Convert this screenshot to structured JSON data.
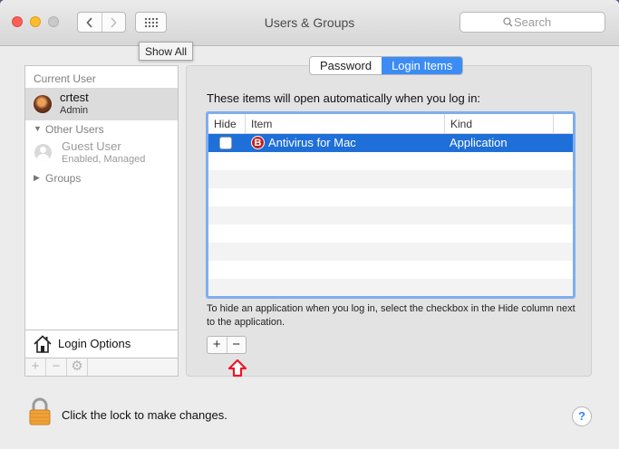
{
  "window": {
    "title": "Users & Groups"
  },
  "toolbar": {
    "back_icon": "chevron-left-icon",
    "forward_icon": "chevron-right-icon",
    "grid_icon": "grid-icon",
    "search_placeholder": "Search",
    "tooltip": "Show All"
  },
  "sidebar": {
    "current_user_header": "Current User",
    "current_user": {
      "name": "crtest",
      "role": "Admin"
    },
    "other_users_header": "Other Users",
    "guest": {
      "name": "Guest User",
      "status": "Enabled, Managed"
    },
    "groups_label": "Groups",
    "login_options": "Login Options",
    "buttons": [
      "+",
      "−",
      "⚙"
    ]
  },
  "tabs": [
    {
      "label": "Password",
      "selected": false
    },
    {
      "label": "Login Items",
      "selected": true
    }
  ],
  "login_items": {
    "intro": "These items will open automatically when you log in:",
    "columns": [
      "Hide",
      "Item",
      "Kind"
    ],
    "rows": [
      {
        "hide": false,
        "icon_letter": "B",
        "item": "Antivirus for Mac",
        "kind": "Application",
        "selected": true
      }
    ],
    "help_text": "To hide an application when you log in, select the checkbox in the Hide column next to the application.",
    "add_label": "+",
    "remove_label": "−"
  },
  "footer": {
    "lock_text": "Click the lock to make changes.",
    "help_label": "?"
  },
  "colors": {
    "accent": "#3b8cf5",
    "selection": "#1f6fd8",
    "arrow": "#e8192c"
  }
}
